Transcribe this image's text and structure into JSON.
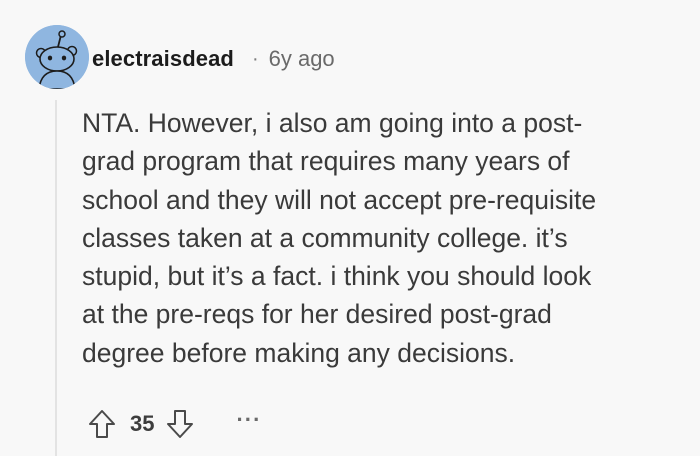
{
  "comment": {
    "author": "electraisdead",
    "separator": "·",
    "age": "6y ago",
    "avatar_icon": "snoo-avatar-icon",
    "body_lines": [
      "NTA. However, i also am going into a post-",
      "grad program that requires many years of",
      "school and they will not accept pre-requisite",
      "classes taken at a community college. it’s",
      "stupid, but it’s a fact. i think you should look",
      "at the pre-reqs for her desired post-grad",
      "degree before making any decisions."
    ],
    "score": "35",
    "upvote_icon": "upvote-arrow-icon",
    "downvote_icon": "downvote-arrow-icon",
    "more_label": "···"
  },
  "colors": {
    "background": "#f8f8f8",
    "avatar_bg": "#8fb6e0",
    "text": "#3a3a3a",
    "thread_line": "#e3e3e3"
  }
}
